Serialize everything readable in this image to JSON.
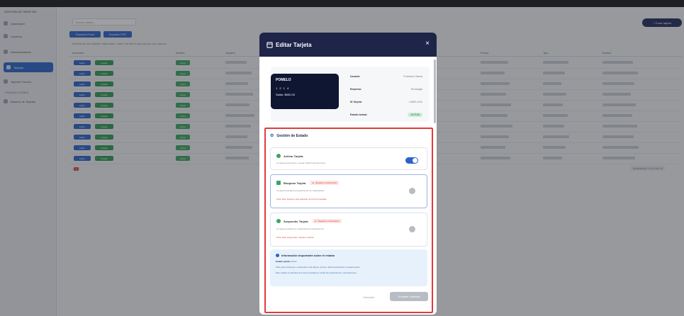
{
  "app": {
    "title": "GESTIÓN DE TARJETAS"
  },
  "sidebar": {
    "items": [
      {
        "label": "Dashboard"
      },
      {
        "label": "Usuarios"
      },
      {
        "label": "Administradores"
      },
      {
        "label": "Tarjetas"
      },
      {
        "label": "Tarjetas Pomelo"
      },
      {
        "label": "Balance de Tarjetas"
      }
    ],
    "section_label": "TRANSACCIONES"
  },
  "toolbar": {
    "search_placeholder": "Buscar tarjeta...",
    "create_label": "+ Crear tarjeta",
    "export_excel_label": "Exportar Excel",
    "export_pdf_label": "Exportar PDF",
    "hint": "Mostrando las tarjetas registradas, utilice los filtros para buscar por usuario."
  },
  "table": {
    "headers": [
      "Acciones",
      "Estado",
      "Usuario",
      "Fecha",
      "Tipo",
      "Emisor"
    ],
    "row_action_label": "Editar",
    "row_view_label": "Detalle",
    "row_status_label": "Activa",
    "count_label": "Mostrando 1 a 10 de 24"
  },
  "pager": {
    "prev": "‹",
    "current": "1",
    "next": "›"
  },
  "modal": {
    "title": "Editar Tarjeta",
    "close_label": "×",
    "card": {
      "brand": "POMELO",
      "number": "1 2 1 4",
      "balance": "Saldo: $500.00"
    },
    "info": [
      {
        "key": "Usuario:",
        "value": "Francisco Garcia"
      },
      {
        "key": "Empresa:",
        "value": "Tecnologia"
      },
      {
        "key": "ID Tarjeta:",
        "value": "CARD-1234"
      },
      {
        "key": "Estado Actual:",
        "value": "ACTIVA"
      }
    ],
    "gestion_title": "Gestión de Estado",
    "options": [
      {
        "title": "Activar Tarjeta",
        "desc": "La tarjeta está activa y puede realizar transacciones",
        "warn": "",
        "note": ""
      },
      {
        "title": "Bloquear Tarjeta",
        "desc": "La tarjeta quedará temporalmente sin capacidades",
        "warn": "Requiere confirmación",
        "note": "Nota: Este bloqueo será aplicado de forma inmediata"
      },
      {
        "title": "Suspender Tarjeta",
        "desc": "La tarjeta quedará sin capacidad de transacciones",
        "warn": "Requiere confirmación",
        "note": "Nota: Esta suspensión requiere revisión"
      }
    ],
    "infobox": {
      "title": "Información importante sobre el estado",
      "current_label": "Estado actual:",
      "current_value": "Activa",
      "line1": "Para poder bloquear o suspender esta tarjeta, primero deberá desactivar el estado activo.",
      "line2": "Este estado se aplicará de forma inmediata en todas las operaciones y transacciones."
    },
    "cancel_label": "Cancelar",
    "confirm_label": "Guardar Cambios"
  }
}
